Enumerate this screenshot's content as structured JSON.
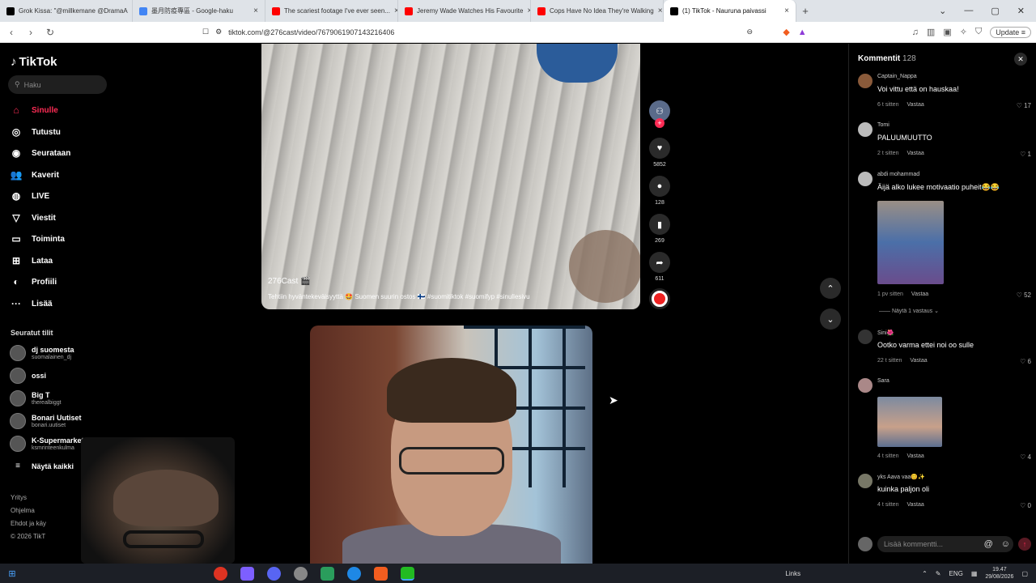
{
  "browser": {
    "tabs": [
      {
        "label": "Grok Kissa: \"@millkemane @DramaA",
        "color": "#000000"
      },
      {
        "label": "墨月防疫專區 - Google-haku",
        "color": "#4285f4"
      },
      {
        "label": "The scariest footage I've ever seen...",
        "color": "#ff0000"
      },
      {
        "label": "Jeremy Wade Watches His Favourite",
        "color": "#ff0000"
      },
      {
        "label": "Cops Have No Idea They're Walking",
        "color": "#ff0000"
      },
      {
        "label": "(1) TikTok - Nauruna paivassi",
        "color": "#000000"
      }
    ],
    "new_tab": "+",
    "url": "tiktok.com/@276cast/video/7679061907143216406",
    "update_label": "Update"
  },
  "sidebar": {
    "logo": "TikTok",
    "search_placeholder": "Haku",
    "nav": [
      {
        "label": "Sinulle",
        "icon": "home-icon",
        "glyph": "⌂"
      },
      {
        "label": "Tutustu",
        "icon": "compass-icon",
        "glyph": "◎"
      },
      {
        "label": "Seurataan",
        "icon": "following-icon",
        "glyph": "◉"
      },
      {
        "label": "Kaverit",
        "icon": "friends-icon",
        "glyph": "👥"
      },
      {
        "label": "LIVE",
        "icon": "live-icon",
        "glyph": "◍"
      },
      {
        "label": "Viestit",
        "icon": "messages-icon",
        "glyph": "▽"
      },
      {
        "label": "Toiminta",
        "icon": "activity-icon",
        "glyph": "▭"
      },
      {
        "label": "Lataa",
        "icon": "upload-icon",
        "glyph": "⊞"
      },
      {
        "label": "Profiili",
        "icon": "profile-icon",
        "glyph": "◐"
      },
      {
        "label": "Lisää",
        "icon": "more-icon",
        "glyph": "···"
      }
    ],
    "following_title": "Seuratut tilit",
    "following": [
      {
        "name": "dj suomesta",
        "handle": "suomalainen_dj"
      },
      {
        "name": "ossi",
        "handle": ""
      },
      {
        "name": "Big T",
        "handle": "therealbiggt"
      },
      {
        "name": "Bonari Uutiset",
        "handle": "bonari.uutiset"
      },
      {
        "name": "K-Supermarket Rint...",
        "handle": "ksmrinteenkulma"
      }
    ],
    "show_all": "Näytä kaikki",
    "footer": [
      "Yritys",
      "Ohjelma",
      "Ehdot ja käy",
      "© 2026 TikT"
    ]
  },
  "video1": {
    "username": "276Cast 🎬",
    "description": "Tehtiin hyväntekeväisyyttä 🤩 Suomen suurin ostos 🇫🇮 #suomitiktok #suomifyp #sinullesivu"
  },
  "actions": {
    "likes": "5852",
    "comments": "128",
    "saves": "269",
    "shares": "611"
  },
  "comments_panel": {
    "title": "Kommentit",
    "count": "128",
    "items": [
      {
        "user": "Captain_Nappa",
        "text": "Voi vittu että on hauskaa!",
        "time": "6 t sitten",
        "reply": "Vastaa",
        "likes": "17"
      },
      {
        "user": "Tomi",
        "text": "PALUUMUUTTO",
        "time": "2 t sitten",
        "reply": "Vastaa",
        "likes": "1"
      },
      {
        "user": "abdi mohammad",
        "text": "Äijä alko lukee motivaatio puheit😂😂",
        "time": "1 pv sitten",
        "reply": "Vastaa",
        "likes": "52"
      },
      {
        "user": "Sini🌺",
        "text": "Ootko varma ettei noi oo sulle",
        "time": "22 t sitten",
        "reply": "Vastaa",
        "likes": "6"
      },
      {
        "user": "Sara",
        "text": "",
        "time": "4 t sitten",
        "reply": "Vastaa",
        "likes": "4"
      },
      {
        "user": "yks Aava vaa😊✨",
        "text": "kuinka paljon oli",
        "time": "4 t sitten",
        "reply": "Vastaa",
        "likes": "0"
      }
    ],
    "view_replies": "—— Näytä 1 vastaus ⌄",
    "input_placeholder": "Lisää kommentti..."
  },
  "taskbar": {
    "links": "Links",
    "lang": "ENG",
    "time": "19.47",
    "date": "29/08/2026"
  }
}
